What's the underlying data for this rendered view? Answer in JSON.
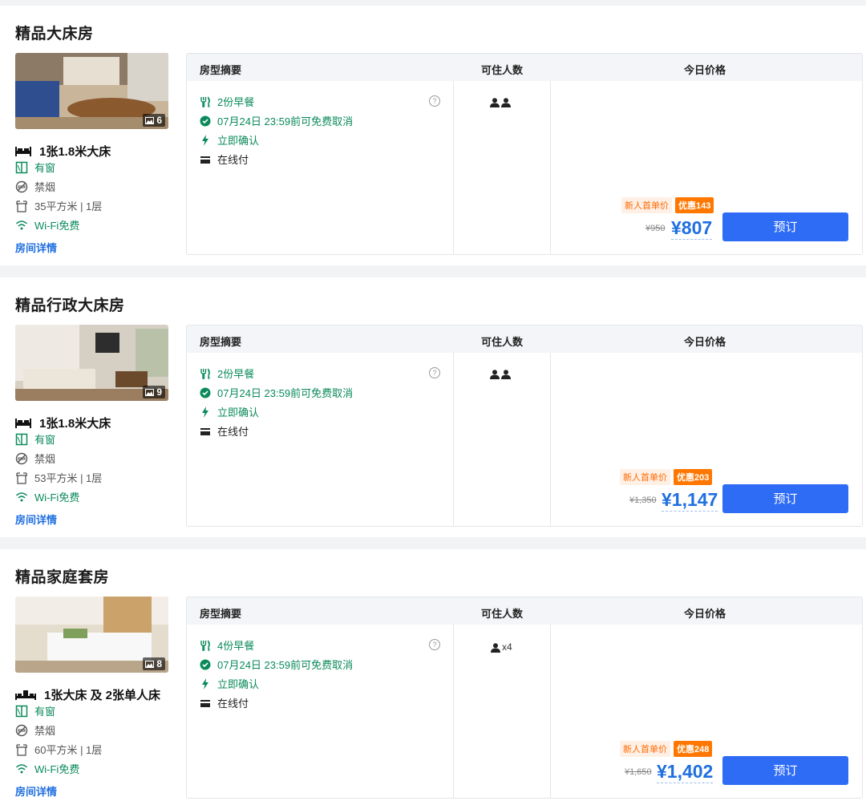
{
  "table_headers": {
    "summary": "房型摘要",
    "occupancy": "可住人数",
    "price": "今日价格"
  },
  "detail_link": "房间详情",
  "rooms": [
    {
      "name": "精品大床房",
      "photo_count": "6",
      "bed": "1张1.8米大床",
      "window": "有窗",
      "smoking": "禁烟",
      "area": "35平方米 | 1层",
      "wifi": "Wi-Fi免费",
      "breakfast": "2份早餐",
      "cancel": "07月24日 23:59前可免费取消",
      "confirm": "立即确认",
      "payment": "在线付",
      "occupancy_text": "",
      "promo_label": "新人首单价",
      "discount": "优惠143",
      "original_price": "¥950",
      "price": "¥807",
      "book": "预订"
    },
    {
      "name": "精品行政大床房",
      "photo_count": "9",
      "bed": "1张1.8米大床",
      "window": "有窗",
      "smoking": "禁烟",
      "area": "53平方米 | 1层",
      "wifi": "Wi-Fi免费",
      "breakfast": "2份早餐",
      "cancel": "07月24日 23:59前可免费取消",
      "confirm": "立即确认",
      "payment": "在线付",
      "occupancy_text": "",
      "promo_label": "新人首单价",
      "discount": "优惠203",
      "original_price": "¥1,350",
      "price": "¥1,147",
      "book": "预订"
    },
    {
      "name": "精品家庭套房",
      "photo_count": "8",
      "bed": "1张大床 及 2张单人床",
      "window": "有窗",
      "smoking": "禁烟",
      "area": "60平方米 | 1层",
      "wifi": "Wi-Fi免费",
      "breakfast": "4份早餐",
      "cancel": "07月24日 23:59前可免费取消",
      "confirm": "立即确认",
      "payment": "在线付",
      "occupancy_text": "x4",
      "promo_label": "新人首单价",
      "discount": "优惠248",
      "original_price": "¥1,650",
      "price": "¥1,402",
      "book": "预订"
    }
  ],
  "colors": {
    "accent": "#2f6cf6",
    "price": "#1f6fe0",
    "green": "#0a8a5a",
    "promo": "#ff7700"
  }
}
